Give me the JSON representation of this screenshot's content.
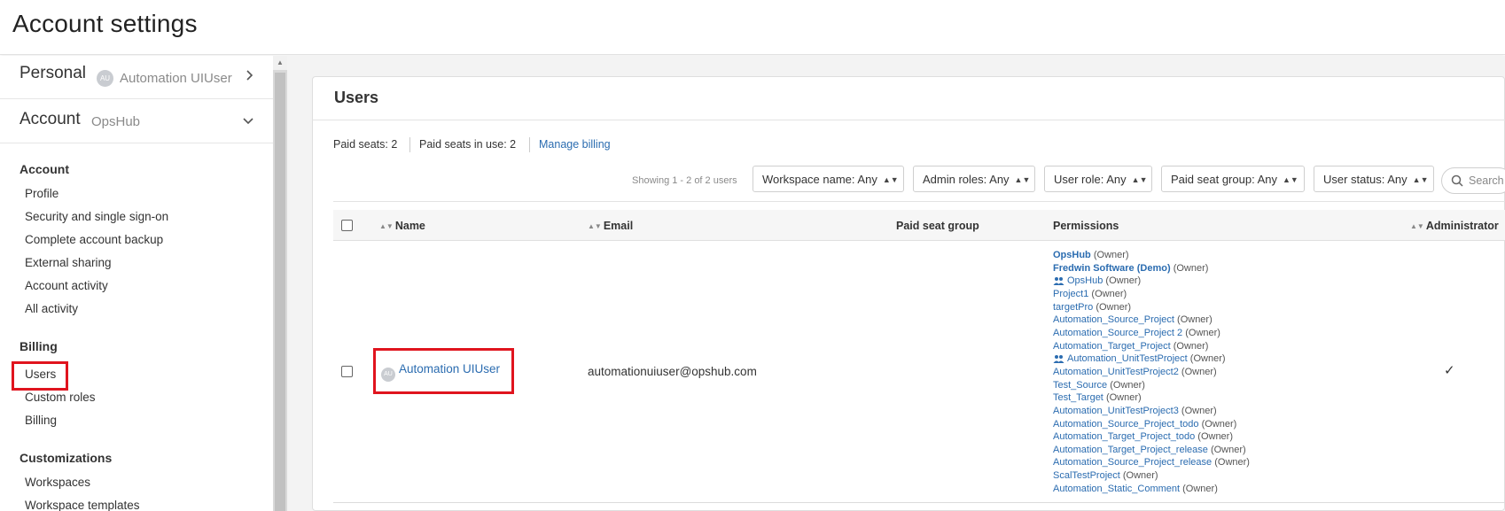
{
  "page_title": "Account settings",
  "sidebar": {
    "personal": {
      "label": "Personal",
      "avatar_initials": "AU",
      "user_name": "Automation UIUser"
    },
    "account": {
      "label": "Account",
      "org_name": "OpsHub"
    },
    "sections": [
      {
        "title": "Account",
        "items": [
          "Profile",
          "Security and single sign-on",
          "Complete account backup",
          "External sharing",
          "Account activity",
          "All activity"
        ]
      },
      {
        "title": "Billing",
        "items": [
          "Users",
          "Custom roles",
          "Billing"
        ]
      },
      {
        "title": "Customizations",
        "items": [
          "Workspaces",
          "Workspace templates"
        ]
      }
    ],
    "selected_item": "Users"
  },
  "card": {
    "title": "Users",
    "paid_seats": "Paid seats: 2",
    "paid_seats_in_use": "Paid seats in use: 2",
    "manage_billing": "Manage billing",
    "showing": "Showing 1 - 2 of 2 users",
    "filters": [
      "Workspace name: Any",
      "Admin roles: Any",
      "User role: Any",
      "Paid seat group: Any",
      "User status: Any"
    ],
    "search_placeholder": "Search"
  },
  "table": {
    "columns": [
      "Name",
      "Email",
      "Paid seat group",
      "Permissions",
      "Administrator"
    ],
    "rows": [
      {
        "avatar_initials": "AU",
        "name": "Automation UIUser",
        "email": "automationuiuser@opshub.com",
        "paid_seat_group": "",
        "administrator": "✓",
        "permissions": [
          {
            "name": "OpsHub",
            "role": "(Owner)",
            "bold": true,
            "team": false
          },
          {
            "name": "Fredwin Software (Demo)",
            "role": "(Owner)",
            "bold": true,
            "team": false
          },
          {
            "name": "OpsHub",
            "role": "(Owner)",
            "bold": false,
            "team": true
          },
          {
            "name": "Project1",
            "role": "(Owner)",
            "bold": false,
            "team": false
          },
          {
            "name": "targetPro",
            "role": "(Owner)",
            "bold": false,
            "team": false
          },
          {
            "name": "Automation_Source_Project",
            "role": "(Owner)",
            "bold": false,
            "team": false
          },
          {
            "name": "Automation_Source_Project 2",
            "role": "(Owner)",
            "bold": false,
            "team": false
          },
          {
            "name": "Automation_Target_Project",
            "role": "(Owner)",
            "bold": false,
            "team": false
          },
          {
            "name": "Automation_UnitTestProject",
            "role": "(Owner)",
            "bold": false,
            "team": true
          },
          {
            "name": "Automation_UnitTestProject2",
            "role": "(Owner)",
            "bold": false,
            "team": false
          },
          {
            "name": "Test_Source",
            "role": "(Owner)",
            "bold": false,
            "team": false
          },
          {
            "name": "Test_Target",
            "role": "(Owner)",
            "bold": false,
            "team": false
          },
          {
            "name": "Automation_UnitTestProject3",
            "role": "(Owner)",
            "bold": false,
            "team": false
          },
          {
            "name": "Automation_Source_Project_todo",
            "role": "(Owner)",
            "bold": false,
            "team": false
          },
          {
            "name": "Automation_Target_Project_todo",
            "role": "(Owner)",
            "bold": false,
            "team": false
          },
          {
            "name": "Automation_Target_Project_release",
            "role": "(Owner)",
            "bold": false,
            "team": false
          },
          {
            "name": "Automation_Source_Project_release",
            "role": "(Owner)",
            "bold": false,
            "team": false
          },
          {
            "name": "ScalTestProject",
            "role": "(Owner)",
            "bold": false,
            "team": false
          },
          {
            "name": "Automation_Static_Comment",
            "role": "(Owner)",
            "bold": false,
            "team": false
          }
        ]
      }
    ]
  },
  "colors": {
    "link": "#2b6cb0",
    "highlight": "#e0141e",
    "background": "#f3f3f3"
  }
}
